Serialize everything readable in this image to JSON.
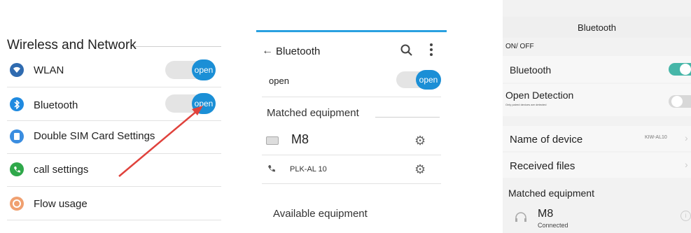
{
  "panel1": {
    "title": "Wireless and Network",
    "items": [
      {
        "label": "WLAN",
        "icon": "wifi-icon",
        "toggle": "open"
      },
      {
        "label": "Bluetooth",
        "icon": "bluetooth-icon",
        "toggle": "open"
      },
      {
        "label": "Double SIM Card Settings",
        "icon": "sim-card-icon"
      },
      {
        "label": "call settings",
        "icon": "phone-icon"
      },
      {
        "label": "Flow usage",
        "icon": "data-usage-icon"
      }
    ],
    "colors": {
      "accent": "#1b8fd6",
      "arrow": "#e0423c"
    }
  },
  "panel2": {
    "header_title": "Bluetooth",
    "open_label": "open",
    "toggle_text": "open",
    "matched_heading": "Matched equipment",
    "devices": [
      {
        "name": "M8",
        "icon": "keyboard-icon"
      },
      {
        "name": "PLK-AL 10",
        "icon": "phone-icon"
      }
    ],
    "available_heading": "Available equipment",
    "colors": {
      "accent": "#1b8fd6",
      "topbar": "#2aa0e0"
    }
  },
  "panel3": {
    "title": "Bluetooth",
    "section_onoff": "ON/ OFF",
    "bluetooth_label": "Bluetooth",
    "open_detection_label": "Open Detection",
    "open_detection_sub": "Only paired devices are detected",
    "device_name_label": "Name of device",
    "device_name_value": "KIW-AL10",
    "received_files_label": "Received files",
    "matched_heading": "Matched equipment",
    "device_name": "M8",
    "device_status": "Connected",
    "colors": {
      "toggle_on": "#46b6a8"
    }
  }
}
